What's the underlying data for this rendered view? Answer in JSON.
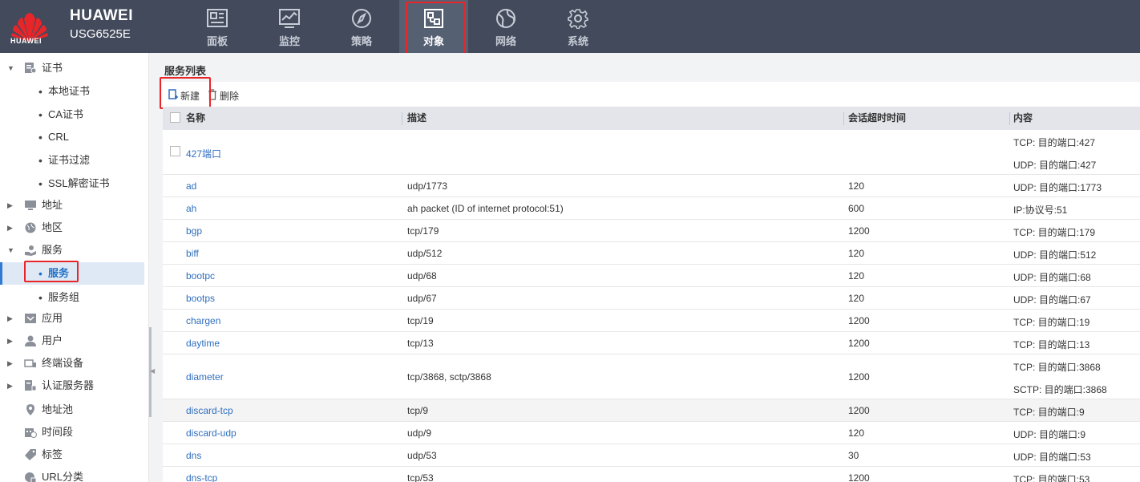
{
  "header": {
    "brand": "HUAWEI",
    "model": "USG6525E",
    "logo_text": "HUAWEI",
    "nav": [
      {
        "label": "面板",
        "icon": "dashboard-icon"
      },
      {
        "label": "监控",
        "icon": "monitor-icon"
      },
      {
        "label": "策略",
        "icon": "compass-icon"
      },
      {
        "label": "对象",
        "icon": "object-icon"
      },
      {
        "label": "网络",
        "icon": "globe-icon"
      },
      {
        "label": "系统",
        "icon": "gear-icon"
      }
    ],
    "active_nav": "对象"
  },
  "sidebar": {
    "items": [
      {
        "label": "证书",
        "expanded": true
      },
      {
        "label": "本地证书"
      },
      {
        "label": "CA证书"
      },
      {
        "label": "CRL"
      },
      {
        "label": "证书过滤"
      },
      {
        "label": "SSL解密证书"
      },
      {
        "label": "地址"
      },
      {
        "label": "地区"
      },
      {
        "label": "服务",
        "expanded": true
      },
      {
        "label": "服务",
        "active": true
      },
      {
        "label": "服务组"
      },
      {
        "label": "应用"
      },
      {
        "label": "用户"
      },
      {
        "label": "终端设备"
      },
      {
        "label": "认证服务器"
      },
      {
        "label": "地址池"
      },
      {
        "label": "时间段"
      },
      {
        "label": "标签"
      },
      {
        "label": "URL分类"
      }
    ]
  },
  "main": {
    "title": "服务列表",
    "toolbar": {
      "new_label": "新建",
      "delete_label": "删除"
    },
    "columns": [
      "名称",
      "描述",
      "会话超时时间",
      "内容"
    ],
    "rows": [
      {
        "name": "427端口",
        "desc": "",
        "timeout": "",
        "content": [
          "TCP: 目的端口:427",
          "UDP: 目的端口:427"
        ],
        "checkbox": true
      },
      {
        "name": "ad",
        "desc": "udp/1773",
        "timeout": "120",
        "content": [
          "UDP: 目的端口:1773"
        ]
      },
      {
        "name": "ah",
        "desc": "ah packet (ID of internet protocol:51)",
        "timeout": "600",
        "content": [
          "IP:协议号:51"
        ]
      },
      {
        "name": "bgp",
        "desc": "tcp/179",
        "timeout": "1200",
        "content": [
          "TCP: 目的端口:179"
        ]
      },
      {
        "name": "biff",
        "desc": "udp/512",
        "timeout": "120",
        "content": [
          "UDP: 目的端口:512"
        ]
      },
      {
        "name": "bootpc",
        "desc": "udp/68",
        "timeout": "120",
        "content": [
          "UDP: 目的端口:68"
        ]
      },
      {
        "name": "bootps",
        "desc": "udp/67",
        "timeout": "120",
        "content": [
          "UDP: 目的端口:67"
        ]
      },
      {
        "name": "chargen",
        "desc": "tcp/19",
        "timeout": "1200",
        "content": [
          "TCP: 目的端口:19"
        ]
      },
      {
        "name": "daytime",
        "desc": "tcp/13",
        "timeout": "1200",
        "content": [
          "TCP: 目的端口:13"
        ]
      },
      {
        "name": "diameter",
        "desc": "tcp/3868, sctp/3868",
        "timeout": "1200",
        "content": [
          "TCP: 目的端口:3868",
          "SCTP: 目的端口:3868"
        ]
      },
      {
        "name": "discard-tcp",
        "desc": "tcp/9",
        "timeout": "1200",
        "content": [
          "TCP: 目的端口:9"
        ],
        "highlight": true
      },
      {
        "name": "discard-udp",
        "desc": "udp/9",
        "timeout": "120",
        "content": [
          "UDP: 目的端口:9"
        ]
      },
      {
        "name": "dns",
        "desc": "udp/53",
        "timeout": "30",
        "content": [
          "UDP: 目的端口:53"
        ]
      },
      {
        "name": "dns-tcp",
        "desc": "tcp/53",
        "timeout": "1200",
        "content": [
          "TCP: 目的端口:53"
        ]
      }
    ]
  },
  "colors": {
    "header_bg": "#424a5b",
    "link": "#2f6fbf",
    "highlight_box": "#e8262a",
    "active_bg": "#dfe9f5"
  }
}
